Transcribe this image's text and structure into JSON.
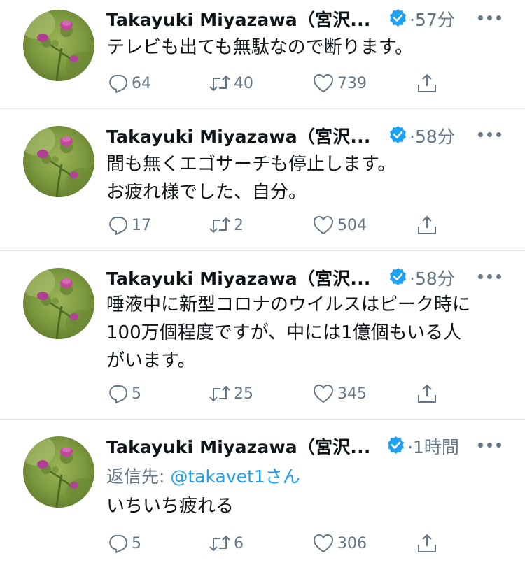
{
  "tweets": [
    {
      "author": "Takayuki Miyazawa（宮沢...",
      "time": "·57分",
      "text_lines": [
        "テレビも出ても無駄なので断ります。"
      ],
      "reply_count": "64",
      "retweet_count": "40",
      "like_count": "739"
    },
    {
      "author": "Takayuki Miyazawa（宮沢...",
      "time": "·58分",
      "text_lines": [
        "間も無くエゴサーチも停止します。",
        "お疲れ様でした、自分。"
      ],
      "reply_count": "17",
      "retweet_count": "2",
      "like_count": "504"
    },
    {
      "author": "Takayuki Miyazawa（宮沢...",
      "time": "·58分",
      "text_lines": [
        "唾液中に新型コロナのウイルスはピーク時に",
        "100万個程度ですが、中には1億個もいる人",
        "がいます。"
      ],
      "reply_count": "5",
      "retweet_count": "25",
      "like_count": "345"
    },
    {
      "author": "Takayuki Miyazawa（宮沢...",
      "time": "·1時間",
      "reply_prefix": "返信先: ",
      "reply_mention": "@takavet1さん",
      "text_lines": [
        "いちいち疲れる"
      ],
      "reply_count": "5",
      "retweet_count": "6",
      "like_count": "306"
    }
  ],
  "colors": {
    "text": "#0f1419",
    "secondary": "#657786",
    "verified": "#1da1f2",
    "mention": "#1da1f2",
    "divider": "#e1e4e8"
  },
  "icons": [
    "thistle-avatar",
    "verified-badge-icon",
    "more-icon",
    "reply-icon",
    "retweet-icon",
    "like-icon",
    "share-icon"
  ]
}
